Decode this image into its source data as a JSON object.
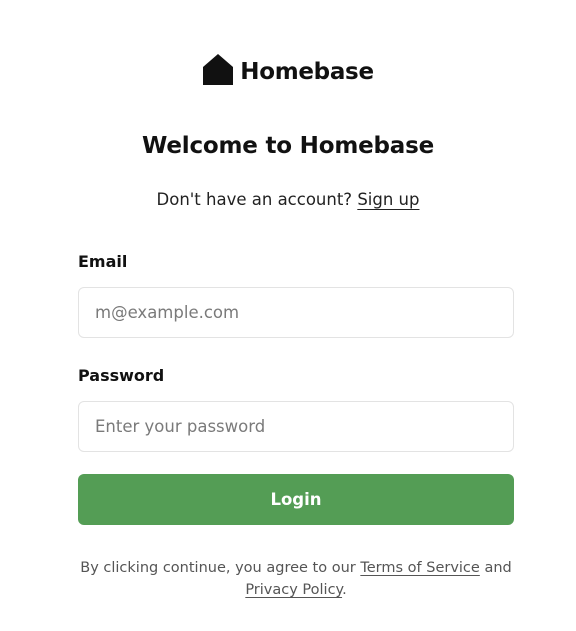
{
  "brand": {
    "name": "Homebase",
    "icon": "house-icon"
  },
  "heading": {
    "title": "Welcome to Homebase"
  },
  "signup": {
    "prompt": "Don't have an account?",
    "link_label": "Sign up"
  },
  "form": {
    "email_label": "Email",
    "email_placeholder": "m@example.com",
    "email_value": "",
    "password_label": "Password",
    "password_placeholder": "Enter your password",
    "password_value": "",
    "submit_label": "Login"
  },
  "legal": {
    "prefix": "By clicking continue, you agree to our",
    "terms_label": "Terms of Service",
    "conjunction": "and",
    "privacy_label": "Privacy Policy",
    "suffix": "."
  },
  "colors": {
    "accent": "#549d55",
    "text": "#111111",
    "muted": "#555555",
    "border": "#e3e3e3"
  }
}
